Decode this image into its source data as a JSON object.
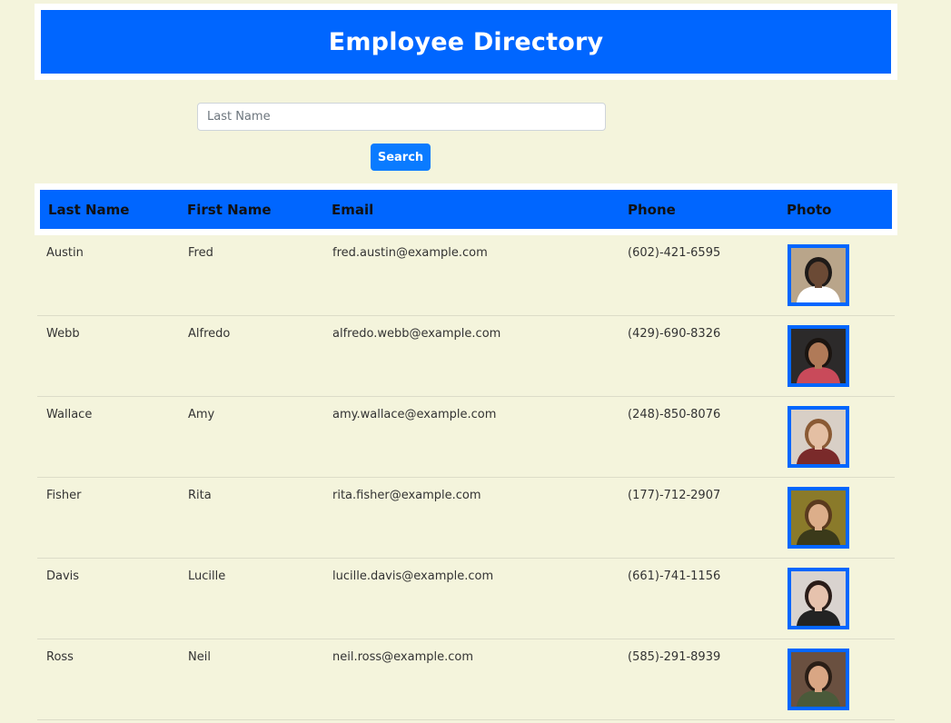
{
  "header": {
    "title": "Employee Directory"
  },
  "search": {
    "placeholder": "Last Name",
    "value": "",
    "button_label": "Search"
  },
  "table": {
    "columns": [
      "Last Name",
      "First Name",
      "Email",
      "Phone",
      "Photo"
    ],
    "rows": [
      {
        "last": "Austin",
        "first": "Fred",
        "email": "fred.austin@example.com",
        "phone": "(602)-421-6595",
        "photo": "employee-photo-icon"
      },
      {
        "last": "Webb",
        "first": "Alfredo",
        "email": "alfredo.webb@example.com",
        "phone": "(429)-690-8326",
        "photo": "employee-photo-icon"
      },
      {
        "last": "Wallace",
        "first": "Amy",
        "email": "amy.wallace@example.com",
        "phone": "(248)-850-8076",
        "photo": "employee-photo-icon"
      },
      {
        "last": "Fisher",
        "first": "Rita",
        "email": "rita.fisher@example.com",
        "phone": "(177)-712-2907",
        "photo": "employee-photo-icon"
      },
      {
        "last": "Davis",
        "first": "Lucille",
        "email": "lucille.davis@example.com",
        "phone": "(661)-741-1156",
        "photo": "employee-photo-icon"
      },
      {
        "last": "Ross",
        "first": "Neil",
        "email": "neil.ross@example.com",
        "phone": "(585)-291-8939",
        "photo": "employee-photo-icon"
      }
    ]
  },
  "colors": {
    "page_background": "#f4f4dc",
    "accent_blue": "#0066ff",
    "button_blue": "#0a7bff"
  }
}
